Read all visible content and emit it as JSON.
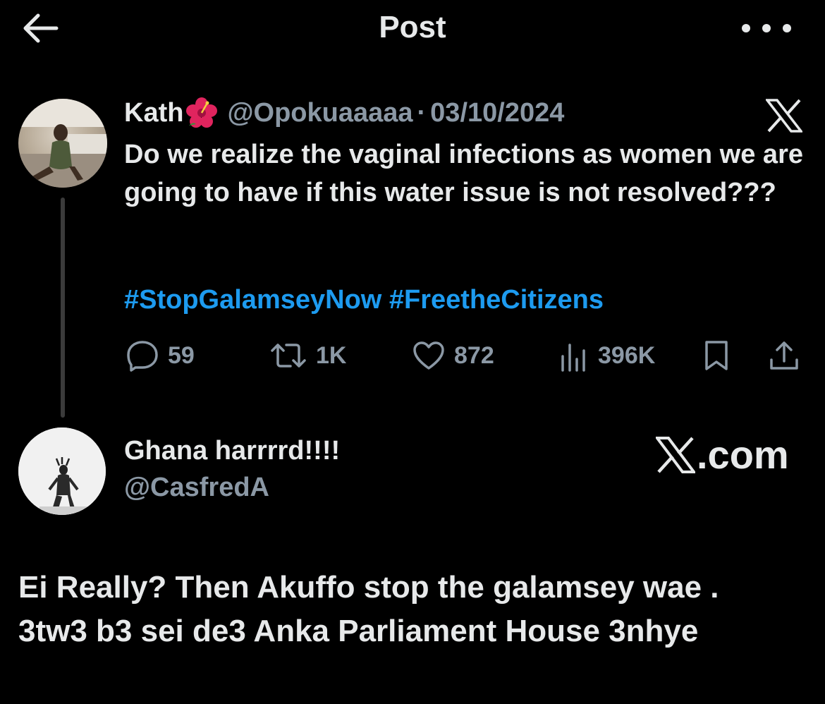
{
  "topbar": {
    "title": "Post"
  },
  "quoted_post": {
    "display_name": "Kath",
    "handle": "@Opokuaaaaa",
    "separator": "·",
    "date": "03/10/2024",
    "text": "Do we realize the vaginal infections as women we are going to have if this water issue is not resolved???",
    "hashtags": "#StopGalamseyNow #FreetheCitizens",
    "stats": {
      "replies": "59",
      "reposts": "1K",
      "likes": "872",
      "views": "396K"
    }
  },
  "reply_post": {
    "display_name": "Ghana harrrrd!!!!",
    "handle": "@CasfredA",
    "watermark": ".com",
    "text_line1": "Ei Really? Then Akuffo stop the galamsey wae .",
    "text_line2": "3tw3 b3 sei de3 Anka Parliament House 3nhye"
  },
  "colors": {
    "background": "#000000",
    "text": "#e7e9ea",
    "muted": "#8b98a5",
    "link": "#1d9bf0"
  },
  "icons": [
    "back-arrow-icon",
    "more-icon",
    "hibiscus-emoji-icon",
    "x-logo-icon",
    "reply-icon",
    "repost-icon",
    "like-icon",
    "views-icon",
    "bookmark-icon",
    "share-icon"
  ]
}
